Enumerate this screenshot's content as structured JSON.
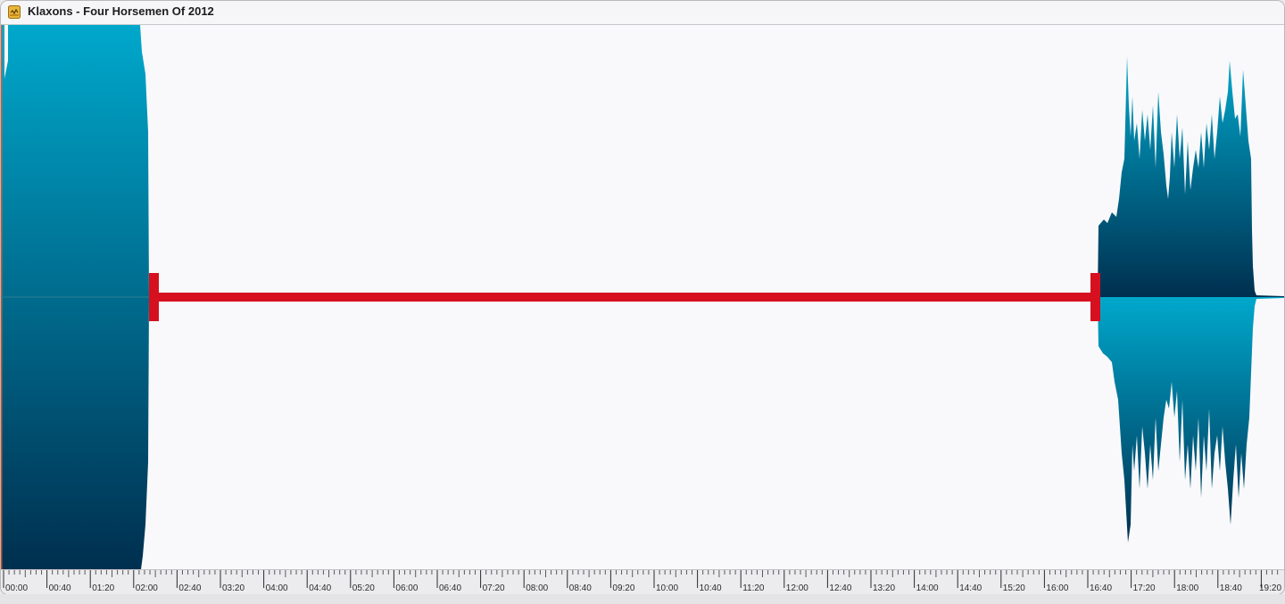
{
  "window": {
    "title": "Klaxons - Four Horsemen Of 2012",
    "app_icon": "audio-file-icon"
  },
  "waveform": {
    "color_top": "#00a8cc",
    "color_bottom": "#002f4f",
    "segments": [
      {
        "start": "00:00",
        "end": "02:05",
        "level": 1.0
      },
      {
        "start": "16:40",
        "end": "18:55",
        "level": 0.9
      }
    ]
  },
  "silence_marker": {
    "start": "02:05",
    "end": "16:40",
    "color": "#d6101f"
  },
  "timeline": {
    "ticks": [
      "00:00",
      "00:40",
      "01:20",
      "02:00",
      "02:40",
      "03:20",
      "04:00",
      "04:40",
      "05:20",
      "06:00",
      "06:40",
      "07:20",
      "08:00",
      "08:40",
      "09:20",
      "10:00",
      "10:40",
      "11:20",
      "12:00",
      "12:40",
      "13:20",
      "14:00",
      "14:40",
      "15:20",
      "16:00",
      "16:40",
      "17:20",
      "18:00",
      "18:40",
      "19:20"
    ]
  }
}
